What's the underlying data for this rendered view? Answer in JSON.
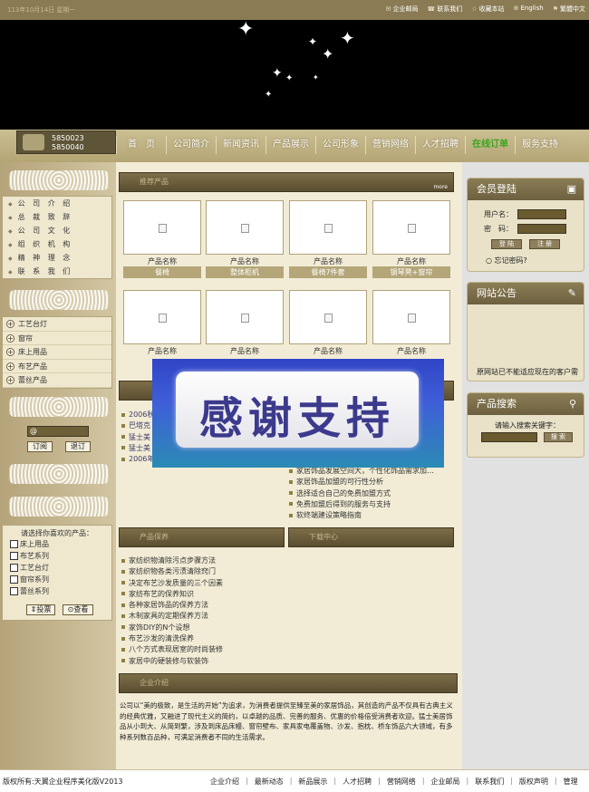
{
  "topbar": {
    "date": "113年10月14日 星期一",
    "links": [
      {
        "icon": "mail-icon",
        "label": "企业邮局"
      },
      {
        "icon": "phone-icon",
        "label": "联系我们"
      },
      {
        "icon": "star-icon",
        "label": "收藏本站"
      },
      {
        "icon": "globe-icon",
        "label": "English"
      },
      {
        "icon": "flag-icon",
        "label": "繁體中文"
      }
    ]
  },
  "phone": {
    "line1": "5850023",
    "line2": "5850040"
  },
  "nav": [
    "首　页",
    "公司简介",
    "新闻资讯",
    "产品展示",
    "公司形象",
    "营销网络",
    "人才招聘",
    "在线订单",
    "服务支持"
  ],
  "left": {
    "about_menu": [
      "公 司 介 绍",
      "总 裁 致 辞",
      "公 司 文 化",
      "组 织 机 构",
      "精 神 理 念",
      "联 系 我 们"
    ],
    "product_menu": [
      "工艺台灯",
      "窗帘",
      "床上用品",
      "布艺产品",
      "蕾丝产品"
    ],
    "subscribe_value": "@",
    "subscribe_label": "订阅",
    "unsubscribe_label": "退订",
    "vote": {
      "title": "请选择你喜欢的产品：",
      "options": [
        "床上用品",
        "布艺系列",
        "工艺台灯",
        "窗帘系列",
        "蕾丝系列"
      ],
      "vote_label": "投票",
      "view_label": "查看"
    }
  },
  "products": {
    "title": "推荐产品",
    "more": "more",
    "row1": [
      {
        "name_label": "产品名称",
        "name": "餐椅"
      },
      {
        "name_label": "产品名称",
        "name": "整体柜机"
      },
      {
        "name_label": "产品名称",
        "name": "餐椅7件套"
      },
      {
        "name_label": "产品名称",
        "name": "钢琴凳+窗帘"
      }
    ],
    "row2": [
      {
        "name_label": "产品名称"
      },
      {
        "name_label": "产品名称"
      },
      {
        "name_label": "产品名称"
      },
      {
        "name_label": "产品名称"
      }
    ]
  },
  "news_left": [
    "2006秋",
    "巴塔克",
    "猛士美",
    "猛士美",
    "2006年"
  ],
  "news_right": [
    "家居饰品发展空间大，个性化饰品需求加…",
    "家居饰品加盟的可行性分析",
    "选择适合自己的免费加盟方式",
    "免费加盟后得到的服务与支持",
    "软终端建设策略指南"
  ],
  "care": {
    "title": "产品保养",
    "title_right": "下载中心",
    "items": [
      "家纺织物清除污点步骤方法",
      "家纺织物各类污渍清除窍门",
      "决定布艺沙发质量的三个因素",
      "家纺布艺的保养知识",
      "各种家居饰品的保养方法",
      "木制家具的定期保养方法",
      "家饰DIY的N个设想",
      "布艺沙发的清洗保养",
      "八个方式表现居室的时尚装修",
      "家居中的硬装修与软装饰"
    ]
  },
  "about": {
    "title": "企业介绍",
    "text": "公司以“美的极致，是生活的开始”为追求，为消费者提供至臻至美的家居饰品，其创造的产品不仅具有古典主义的经典优雅，又融进了现代主义的简约，以卓越的品质、完善的服务、优惠的价格倍受消费者欢迎。猛士美居饰品从小到大、从简到繁，涉及到床品床幔、窗帘壁布、家具家电覆盖物、沙发、抱枕、桥车饰品六大领域，有多种系列数百品种，可满足消费者不同的生活需求。"
  },
  "thanks": "感谢支持",
  "login": {
    "title": "会员登陆",
    "user_label": "用户名：",
    "pass_label": "密　码：",
    "login_btn": "登 陆",
    "register_btn": "注 册",
    "forgot": "忘记密码?"
  },
  "notice": {
    "title": "网站公告",
    "text": "原网站已不能适应现在的客户需"
  },
  "search": {
    "title": "产品搜索",
    "hint": "请输入搜索关键字：",
    "button": "搜 索"
  },
  "footer": {
    "copyright": "版权所有:天翼企业程序美化版V2013",
    "links": [
      "企业介绍",
      "最新动态",
      "新品展示",
      "人才招聘",
      "营销网络",
      "企业邮局",
      "联系我们",
      "版权声明",
      "管理"
    ]
  },
  "colors": {
    "banner": "#000000",
    "nav_highlight": "#39a51f",
    "accent": "#8a7b55"
  }
}
